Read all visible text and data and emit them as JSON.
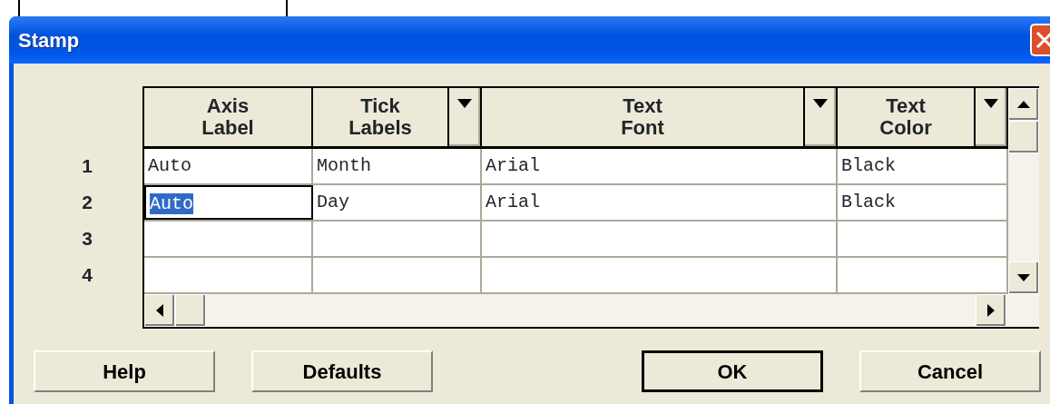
{
  "window": {
    "title": "Stamp"
  },
  "grid": {
    "columns": [
      {
        "label": "Axis\nLabel",
        "dropdown": false
      },
      {
        "label": "Tick\nLabels",
        "dropdown": true
      },
      {
        "label": "Text\nFont",
        "dropdown": true
      },
      {
        "label": "Text\nColor",
        "dropdown": true
      }
    ],
    "rows": [
      {
        "number": "1",
        "cells": [
          {
            "text": "Auto",
            "selected": false
          },
          {
            "text": "Month",
            "selected": false
          },
          {
            "text": "Arial",
            "selected": false
          },
          {
            "text": "Black",
            "selected": false
          }
        ]
      },
      {
        "number": "2",
        "cells": [
          {
            "text": "Auto",
            "selected": true
          },
          {
            "text": "Day",
            "selected": false
          },
          {
            "text": "Arial",
            "selected": false
          },
          {
            "text": "Black",
            "selected": false
          }
        ]
      },
      {
        "number": "3",
        "cells": []
      },
      {
        "number": "4",
        "cells": []
      }
    ]
  },
  "buttons": [
    {
      "label": "Help",
      "default": false
    },
    {
      "label": "Defaults",
      "default": false
    },
    {
      "label": "OK",
      "default": true
    },
    {
      "label": "Cancel",
      "default": false
    }
  ]
}
